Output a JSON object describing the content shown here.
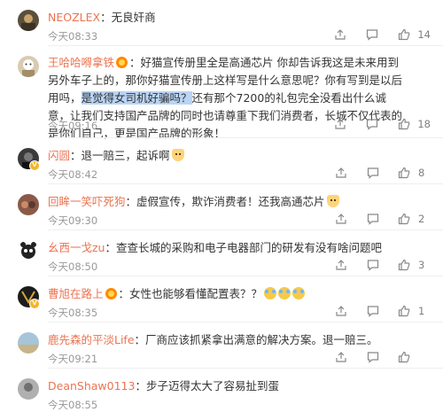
{
  "comments": [
    {
      "username": "NEOZLEX",
      "text": "无良奸商",
      "time": "今天08:33",
      "likes": "14",
      "avatar_color": "#6b5b3a"
    },
    {
      "username": "王哈哈嘚拿铁",
      "text_before": "好猫宣传册里全是高通芯片 你却告诉我这是未来用到另外车子上的，那你好猫宣传册上这样写是什么意思呢？你有写到是以后用吗，",
      "text_highlight": "是觉得女司机好骗吗？",
      "text_after": "还有那个7200的礼包完全没看出什么诚意，让我们支持国产品牌的同时也请尊重下我们消费者，长城不仅代表的是你们自己，更是国产品牌的形象！",
      "time": "今天09:16",
      "likes": "18",
      "avatar_color": "#c9b79a"
    },
    {
      "username": "闪圆",
      "text": "退一赔三，起诉啊",
      "time": "今天08:42",
      "likes": "8",
      "avatar_color": "#2d2d2d"
    },
    {
      "username": "回眸一笑吓死狗",
      "text": "虚假宣传，欺诈消费者！还我高通芯片",
      "time": "今天09:30",
      "likes": "2",
      "avatar_color": "#7a4a3a"
    },
    {
      "username": "幺西一戈zu",
      "text": "查查长城的采购和电子电器部门的研发有没有啥问题吧",
      "time": "今天08:50",
      "likes": "3",
      "avatar_color": "#222222"
    },
    {
      "username": "曹旭在路上",
      "text": "女性也能够看懂配置表？？",
      "time": "今天08:35",
      "likes": "1",
      "avatar_color": "#1c1c1c"
    },
    {
      "username": "鹿先森的平淡Life",
      "text": "厂商应该抓紧拿出满意的解决方案。退一赔三。",
      "time": "今天09:21",
      "likes": "",
      "avatar_color": "#8fb0c8"
    },
    {
      "username": "DeanShaw0113",
      "text": "步子迈得太大了容易扯到蛋",
      "time": "今天08:55",
      "likes": "",
      "avatar_color": "#9a9a9a"
    }
  ],
  "colors": {
    "username": "#eb7350",
    "time": "#999999",
    "highlight": "#b9d4f5",
    "vip_badge": "#f5b52a"
  },
  "icons": [
    "share-icon",
    "comment-icon",
    "like-icon"
  ]
}
